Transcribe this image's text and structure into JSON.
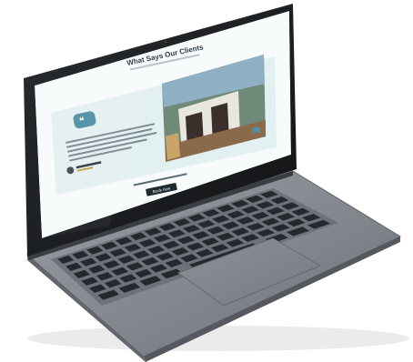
{
  "screen": {
    "heading": "What Says Our Clients",
    "quote_icon": "quote-marks-icon",
    "cta_label": "Book now",
    "colors": {
      "accent": "#4f8fa6",
      "panel": "#e6f2f4",
      "screen_bg": "#f7fbfc"
    }
  },
  "device": {
    "type": "laptop",
    "colors": {
      "body": "#7a7e85",
      "deck": "#8a8e95",
      "keys": "#2b2e33",
      "bezel": "#15171a"
    }
  }
}
